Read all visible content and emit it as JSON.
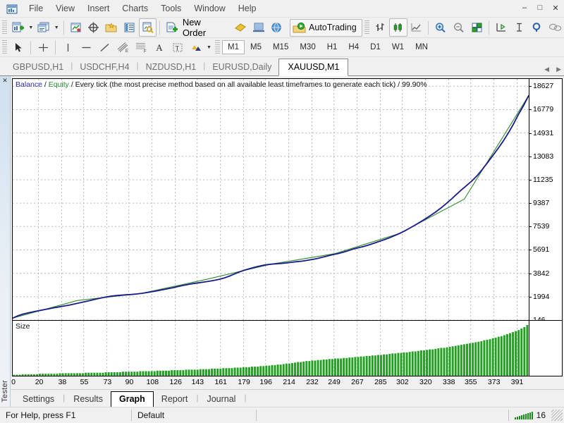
{
  "window": {
    "app_icon": "metatrader-icon",
    "minimize": "–",
    "maximize": "□",
    "close": "✕"
  },
  "menubar": {
    "items": [
      {
        "label": "File"
      },
      {
        "label": "View"
      },
      {
        "label": "Insert"
      },
      {
        "label": "Charts"
      },
      {
        "label": "Tools"
      },
      {
        "label": "Window"
      },
      {
        "label": "Help"
      }
    ]
  },
  "toolbar_main": {
    "new_chart": "new-chart-icon",
    "new_chart_caret": "▼",
    "profiles": "profiles-icon",
    "profiles_caret": "▼",
    "market_watch": "market-watch-icon",
    "navigator": "navigator-icon",
    "data_window": "data-window-icon",
    "terminal": "terminal-icon",
    "strategy_tester": "strategy-tester-icon",
    "new_order_label": "New Order",
    "new_order_icon": "new-order-icon",
    "metaeditor": "metaeditor-icon",
    "metaquotes_id": "metaquotes-id-icon",
    "autotrading_label": "AutoTrading",
    "autotrading_icon": "autotrading-icon",
    "bar_chart": "bar-chart-icon",
    "candlestick_chart": "candlestick-chart-icon",
    "line_chart": "line-chart-icon",
    "zoom_in": "zoom-in-icon",
    "zoom_out": "zoom-out-icon",
    "tile_windows": "tile-windows-icon",
    "auto_scroll": "auto-scroll-icon",
    "chart_shift": "chart-shift-icon",
    "indicators": "indicators-icon",
    "objects": "objects-icon"
  },
  "toolbar_tools": {
    "cursor": "cursor-icon",
    "crosshair": "crosshair-icon",
    "vertical_line": "vertical-line-icon",
    "horizontal_line": "horizontal-line-icon",
    "trendline": "trendline-icon",
    "equidistant_channel": "equidistant-channel-icon",
    "fibonacci": "fibonacci-icon",
    "text": "text-icon",
    "text_label": "text-label-icon",
    "shapes": "shapes-icon",
    "shapes_caret": "▼",
    "timeframes": [
      "M1",
      "M5",
      "M15",
      "M30",
      "H1",
      "H4",
      "D1",
      "W1",
      "MN"
    ],
    "active_timeframe": "M1"
  },
  "chart_tabs": {
    "items": [
      {
        "label": "GBPUSD,H1",
        "active": false
      },
      {
        "label": "USDCHF,H4",
        "active": false
      },
      {
        "label": "NZDUSD,H1",
        "active": false
      },
      {
        "label": "EURUSD,Daily",
        "active": false
      },
      {
        "label": "XAUUSD,M1",
        "active": true
      }
    ],
    "nav_prev": "◀",
    "nav_next": "▶"
  },
  "tester_panel": {
    "close_icon": "✕",
    "title": "Tester"
  },
  "graph": {
    "legend_balance": "Balance",
    "legend_sep1": " / ",
    "legend_equity": "Equity",
    "legend_sep2": " / ",
    "legend_method": "Every tick (the most precise method based on all available least timeframes to generate each tick)",
    "legend_sep3": " / ",
    "legend_quality": "99.90%",
    "volume_label": "Size",
    "balance_color": "#1a1a8c",
    "equity_color": "#2e8b2e",
    "volume_color": "#22a022"
  },
  "bottom_tabs": {
    "items": [
      {
        "label": "Settings",
        "active": false
      },
      {
        "label": "Results",
        "active": false
      },
      {
        "label": "Graph",
        "active": true
      },
      {
        "label": "Report",
        "active": false
      },
      {
        "label": "Journal",
        "active": false
      }
    ],
    "divider": "|"
  },
  "status_bar": {
    "help": "For Help, press F1",
    "profile": "Default",
    "connection": "16",
    "signal_icon": "signal-bars-icon"
  },
  "chart_data": {
    "type": "line",
    "title": "Balance / Equity / Every tick (the most precise method based on all available least timeframes to generate each tick) / 99.90%",
    "xlabel": "",
    "ylabel": "",
    "grid": true,
    "legend": [
      "Balance",
      "Equity"
    ],
    "legend_position": "top-left",
    "yticks": [
      18627,
      16779,
      14931,
      13083,
      11235,
      9387,
      7539,
      5691,
      3842,
      1994,
      146
    ],
    "ylim": [
      146,
      19200
    ],
    "xticks": [
      0,
      20,
      38,
      55,
      73,
      90,
      108,
      126,
      143,
      161,
      179,
      196,
      214,
      232,
      249,
      267,
      285,
      302,
      320,
      338,
      355,
      373,
      391
    ],
    "xlim": [
      0,
      400
    ],
    "series": [
      {
        "name": "Balance",
        "color": "#1a1a8c",
        "x": [
          0,
          4,
          8,
          12,
          16,
          20,
          24,
          28,
          32,
          36,
          40,
          44,
          48,
          52,
          56,
          60,
          64,
          68,
          72,
          76,
          80,
          84,
          88,
          92,
          96,
          100,
          104,
          108,
          112,
          116,
          120,
          124,
          128,
          132,
          136,
          140,
          144,
          148,
          152,
          156,
          160,
          164,
          168,
          172,
          176,
          180,
          184,
          188,
          192,
          196,
          200,
          204,
          208,
          212,
          216,
          220,
          224,
          228,
          232,
          236,
          240,
          244,
          248,
          252,
          256,
          260,
          264,
          268,
          272,
          276,
          280,
          284,
          288,
          292,
          296,
          300,
          304,
          308,
          312,
          316,
          320,
          324,
          328,
          332,
          336,
          340,
          344,
          348,
          352,
          356,
          360,
          364,
          368,
          372,
          376,
          380,
          384,
          388,
          392,
          396,
          400
        ],
        "y": [
          300,
          480,
          620,
          720,
          800,
          880,
          960,
          1040,
          1120,
          1190,
          1260,
          1330,
          1420,
          1510,
          1600,
          1690,
          1790,
          1880,
          1960,
          2030,
          2080,
          2110,
          2140,
          2170,
          2210,
          2260,
          2320,
          2390,
          2460,
          2540,
          2620,
          2700,
          2790,
          2880,
          2960,
          3030,
          3090,
          3150,
          3210,
          3280,
          3360,
          3470,
          3620,
          3790,
          3960,
          4100,
          4220,
          4330,
          4430,
          4510,
          4560,
          4590,
          4620,
          4660,
          4710,
          4760,
          4800,
          4860,
          4930,
          5010,
          5110,
          5210,
          5310,
          5400,
          5500,
          5620,
          5760,
          5860,
          5960,
          6080,
          6220,
          6360,
          6500,
          6650,
          6820,
          7000,
          7200,
          7420,
          7660,
          7900,
          8150,
          8420,
          8700,
          9010,
          9350,
          9700,
          10080,
          10450,
          10800,
          11150,
          11560,
          12050,
          12580,
          13120,
          13680,
          14260,
          14900,
          15600,
          16400,
          17100,
          17900
        ]
      },
      {
        "name": "Equity",
        "color": "#2e8b2e",
        "x": [
          0,
          50,
          100,
          150,
          200,
          250,
          300,
          350,
          400
        ],
        "y": [
          300,
          1690,
          2260,
          3360,
          4560,
          5400,
          7000,
          9700,
          17900
        ]
      }
    ],
    "volume_series": {
      "name": "Size",
      "color": "#22a022",
      "type": "bar",
      "values": [
        2,
        2,
        2,
        3,
        3,
        3,
        3,
        3,
        3,
        4,
        4,
        4,
        4,
        4,
        4,
        4,
        5,
        5,
        5,
        5,
        5,
        5,
        5,
        5,
        5,
        6,
        6,
        6,
        6,
        6,
        6,
        6,
        7,
        7,
        7,
        7,
        7,
        7,
        8,
        8,
        8,
        8,
        8,
        8,
        9,
        9,
        9,
        9,
        9,
        9,
        10,
        10,
        10,
        10,
        10,
        11,
        11,
        11,
        11,
        11,
        12,
        12,
        12,
        12,
        12,
        13,
        13,
        13,
        13,
        14,
        14,
        14,
        14,
        15,
        15,
        15,
        15,
        16,
        16,
        16,
        17,
        17,
        17,
        18,
        18,
        18,
        19,
        19,
        20,
        20,
        21,
        21,
        22,
        22,
        23,
        24,
        24,
        25,
        26,
        27,
        27,
        28,
        29,
        29,
        30,
        30,
        31,
        31,
        32,
        32,
        33,
        33,
        34,
        34,
        34,
        35,
        35,
        36,
        36,
        37,
        37,
        38,
        38,
        39,
        39,
        40,
        40,
        41,
        41,
        42,
        42,
        43,
        44,
        44,
        45,
        45,
        46,
        46,
        47,
        48,
        48,
        49,
        50,
        50,
        51,
        52,
        52,
        53,
        54,
        55,
        55,
        56,
        57,
        58,
        59,
        60,
        61,
        62,
        63,
        64,
        65,
        66,
        67,
        68,
        70,
        71,
        72,
        74,
        75,
        77,
        78,
        80,
        82,
        84,
        86,
        88,
        90,
        93,
        96,
        100
      ]
    }
  }
}
